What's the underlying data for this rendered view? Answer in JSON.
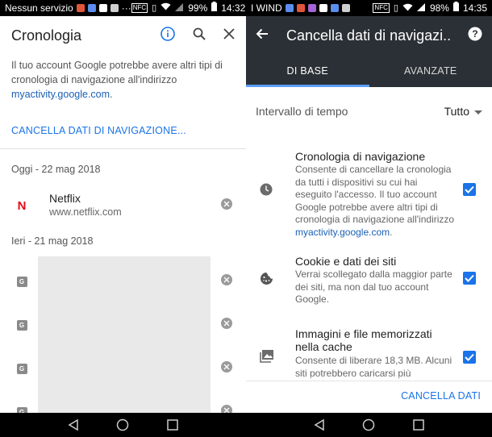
{
  "left": {
    "status": {
      "carrier": "Nessun servizio",
      "more": "···",
      "nfc": "NFC",
      "battery": "99%",
      "time": "14:32"
    },
    "header": {
      "title": "Cronologia"
    },
    "info": {
      "text": "Il tuo account Google potrebbe avere altri tipi di cronologia di navigazione all'indirizzo ",
      "link": "myactivity.google.com",
      "suffix": "."
    },
    "clear_link": "CANCELLA DATI DI NAVIGAZIONE...",
    "groups": [
      {
        "date": "Oggi - 22 mag 2018"
      },
      {
        "date": "Ieri - 21 mag 2018"
      }
    ],
    "entries": [
      {
        "title": "Netflix",
        "url": "www.netflix.com",
        "favicon": "N"
      }
    ],
    "hidden_favicon": "G"
  },
  "right": {
    "status": {
      "carrier": "I WIND",
      "nfc": "NFC",
      "battery": "98%",
      "time": "14:35"
    },
    "header": {
      "title": "Cancella dati di navigazi..."
    },
    "tabs": [
      {
        "label": "DI BASE",
        "active": true
      },
      {
        "label": "AVANZATE",
        "active": false
      }
    ],
    "time_range": {
      "label": "Intervallo di tempo",
      "value": "Tutto"
    },
    "options": [
      {
        "title": "Cronologia di navigazione",
        "desc": "Consente di cancellare la cronologia da tutti i dispositivi su cui hai eseguito l'accesso. Il tuo account Google potrebbe avere altri tipi di cronologia di navigazione all'indirizzo ",
        "link": "myactivity.google.com",
        "suffix": ".",
        "checked": true,
        "icon": "clock-icon"
      },
      {
        "title": "Cookie e dati dei siti",
        "desc": "Verrai scollegato dalla maggior parte dei siti, ma non dal tuo account Google.",
        "checked": true,
        "icon": "cookie-icon"
      },
      {
        "title": "Immagini e file memorizzati nella cache",
        "desc": "Consente di liberare 18,3 MB. Alcuni siti potrebbero caricarsi più",
        "checked": true,
        "icon": "image-icon"
      }
    ],
    "clear_button": "CANCELLA DATI"
  },
  "colors": {
    "accent": "#1a73e8",
    "toolbar": "#2b3036",
    "tab_indicator": "#5c9eff",
    "netflix": "#e50914"
  }
}
